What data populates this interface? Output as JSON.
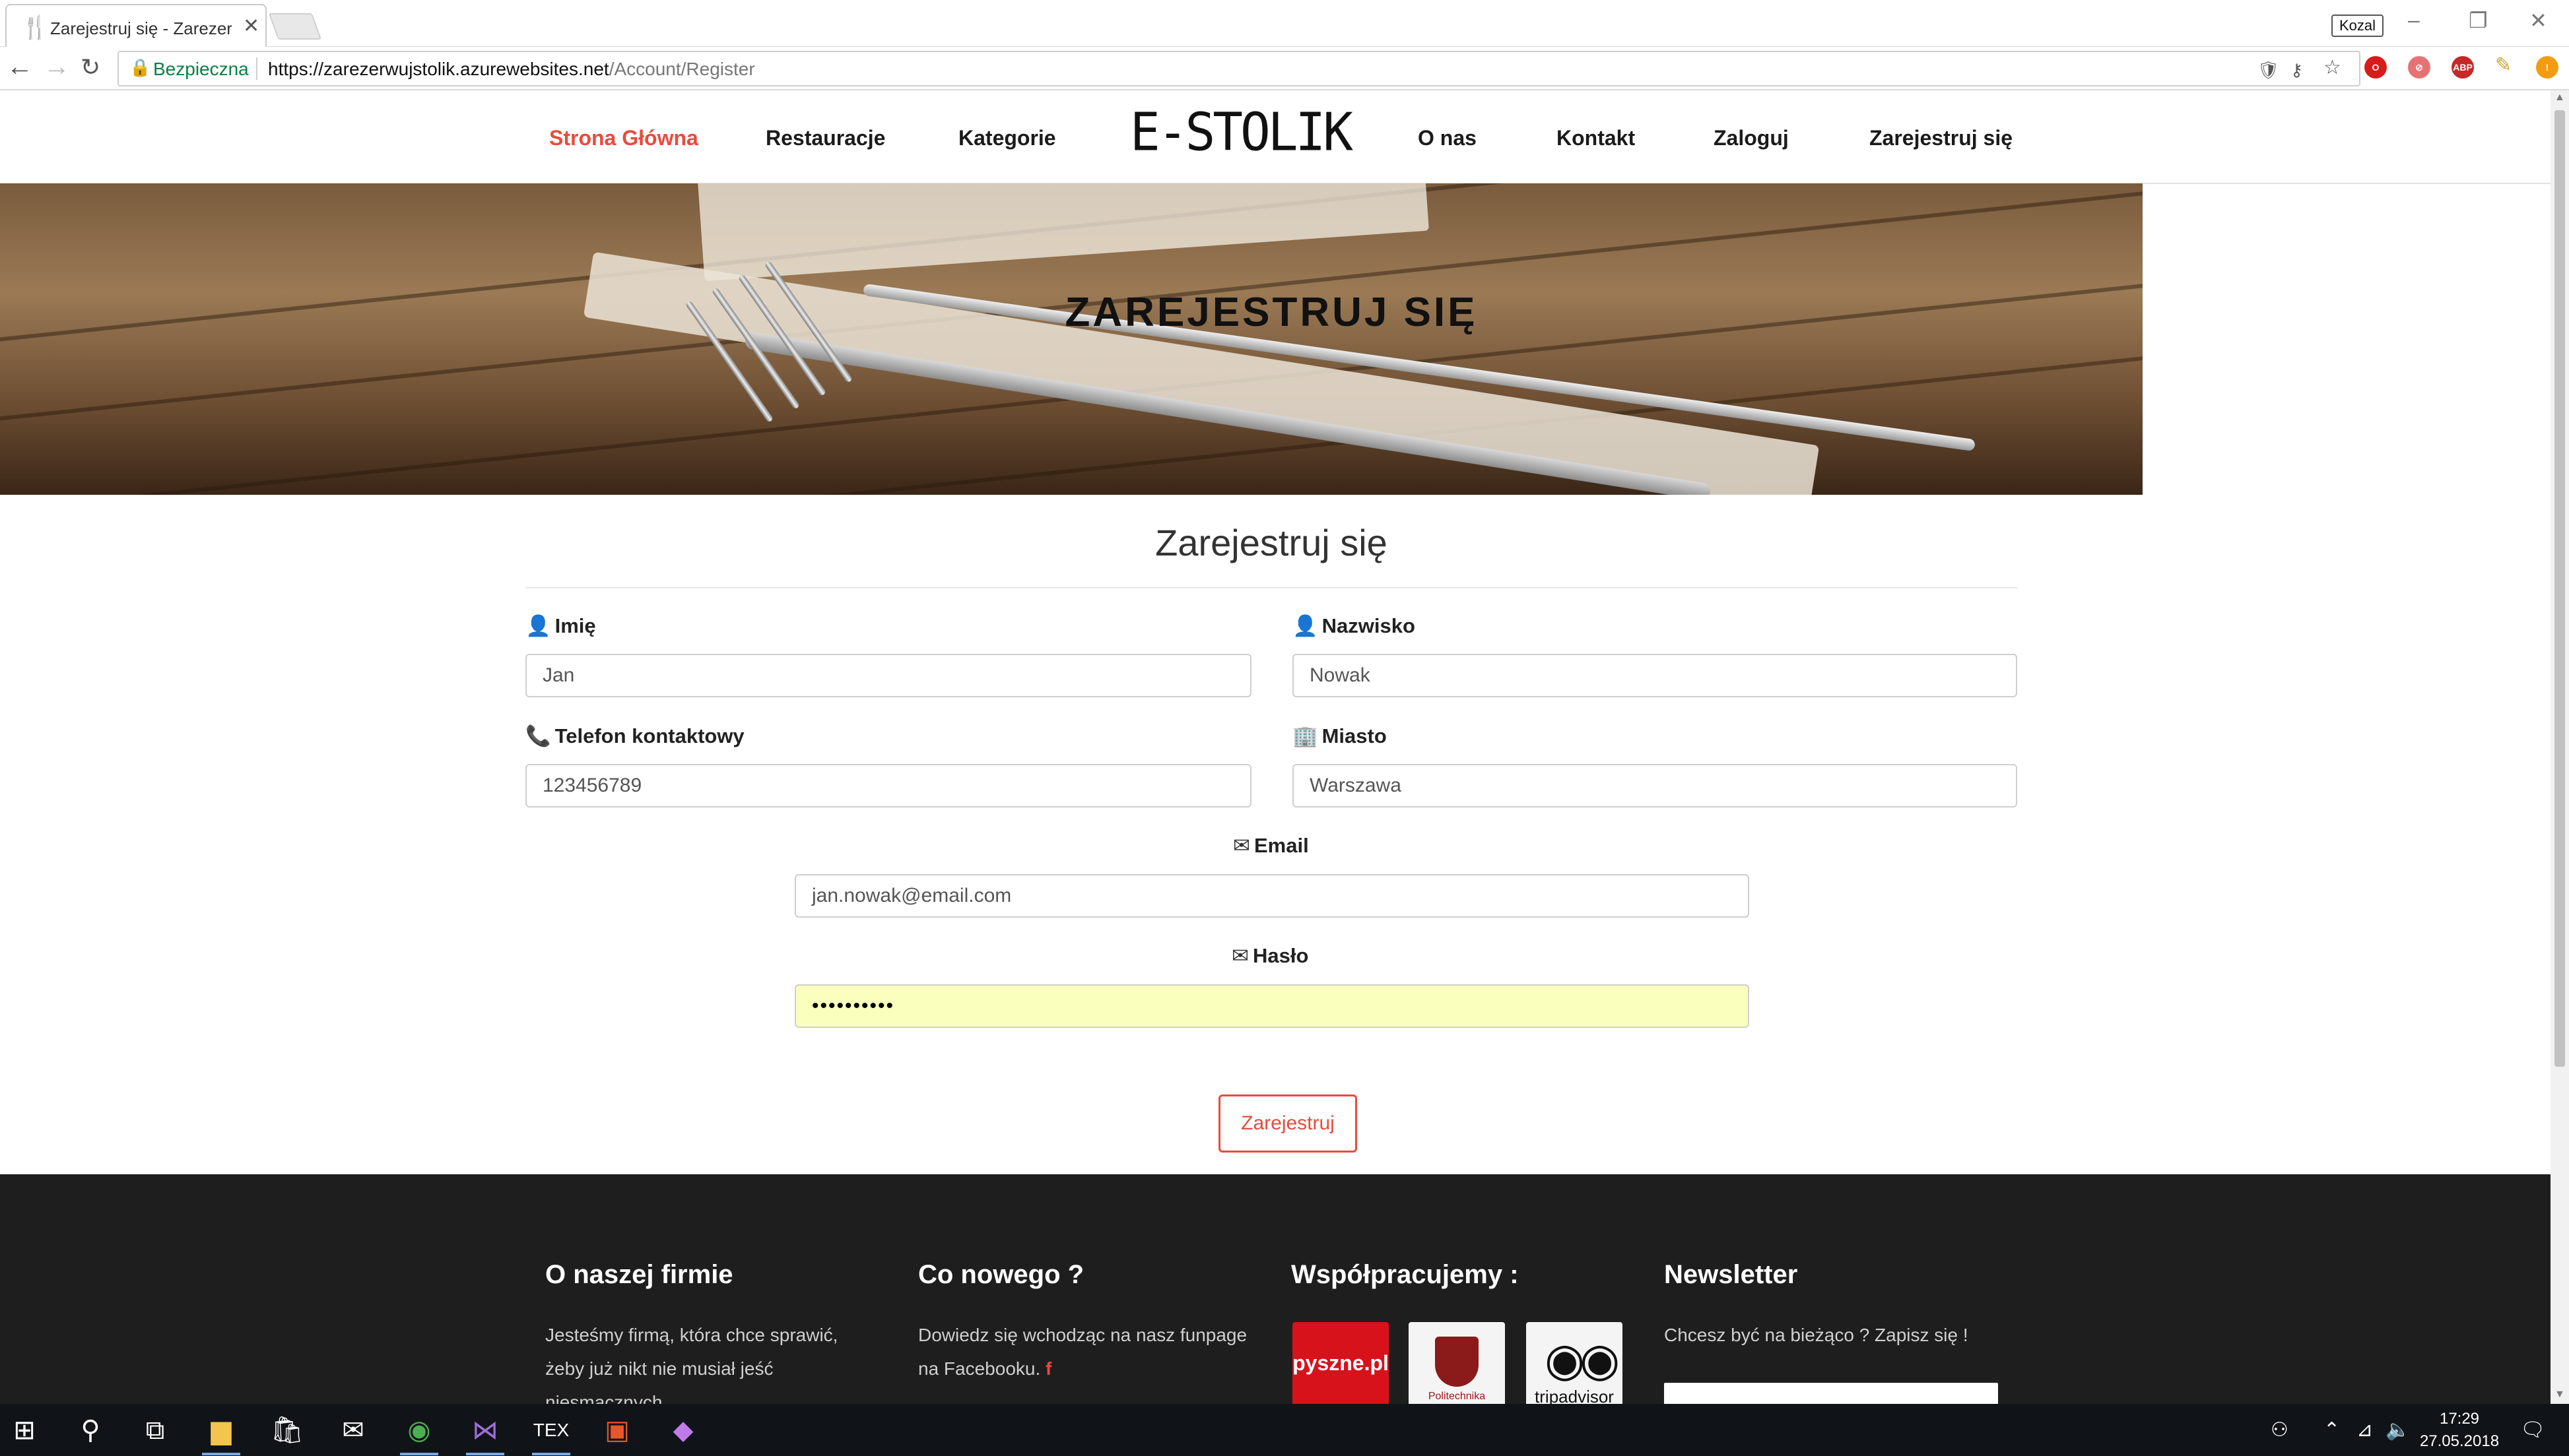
{
  "browser": {
    "tab_title": "Zarejestruj się - Zarezerwuj stolik",
    "tab_close": "✕",
    "profile_name": "Kozal",
    "secure_label": "Bezpieczna",
    "url_host": "https://zarezerwujstolik.azurewebsites.net",
    "url_path": "/Account/Register"
  },
  "nav": {
    "home": "Strona Główna",
    "restaurants": "Restauracje",
    "categories": "Kategorie",
    "logo": "E-STOLIK",
    "about": "O nas",
    "contact": "Kontakt",
    "login": "Zaloguj",
    "register": "Zarejestruj się"
  },
  "hero": {
    "title": "ZAREJESTRUJ SIĘ"
  },
  "form": {
    "title": "Zarejestruj się",
    "first_name": {
      "label": "Imię",
      "value": "Jan"
    },
    "last_name": {
      "label": "Nazwisko",
      "value": "Nowak"
    },
    "phone": {
      "label": "Telefon kontaktowy",
      "value": "123456789"
    },
    "city": {
      "label": "Miasto",
      "value": "Warszawa"
    },
    "email": {
      "label": "Email",
      "value": "jan.nowak@email.com"
    },
    "password": {
      "label": "Hasło",
      "value": "••••••••••"
    },
    "submit": "Zarejestruj"
  },
  "footer": {
    "about_heading": "O naszej firmie",
    "about_text": "Jesteśmy firmą, która chce sprawić, żeby już nikt nie musiał jeść niesmacznych",
    "news_heading": "Co nowego ?",
    "news_text": "Dowiedz się wchodząc na nasz funpage na Facebooku.",
    "partners_heading": "Współpracujemy :",
    "partners": [
      "pyszne.pl",
      "Politechnika",
      "tripadvisor"
    ],
    "newsletter_heading": "Newsletter",
    "newsletter_text": "Chcesz być na bieżąco ? Zapisz się !"
  },
  "taskbar": {
    "time": "17:29",
    "date": "27.05.2018"
  },
  "colors": {
    "accent": "#e74c3c",
    "footer_bg": "#1e1e1e",
    "autofill": "#faffbd",
    "secure_green": "#0b8043"
  },
  "icons": [
    "back-icon",
    "forward-icon",
    "reload-icon",
    "lock-icon",
    "key-icon",
    "star-icon",
    "user-icon",
    "phone-icon",
    "building-icon",
    "envelope-icon",
    "facebook-icon",
    "windows-start-icon",
    "search-icon"
  ]
}
